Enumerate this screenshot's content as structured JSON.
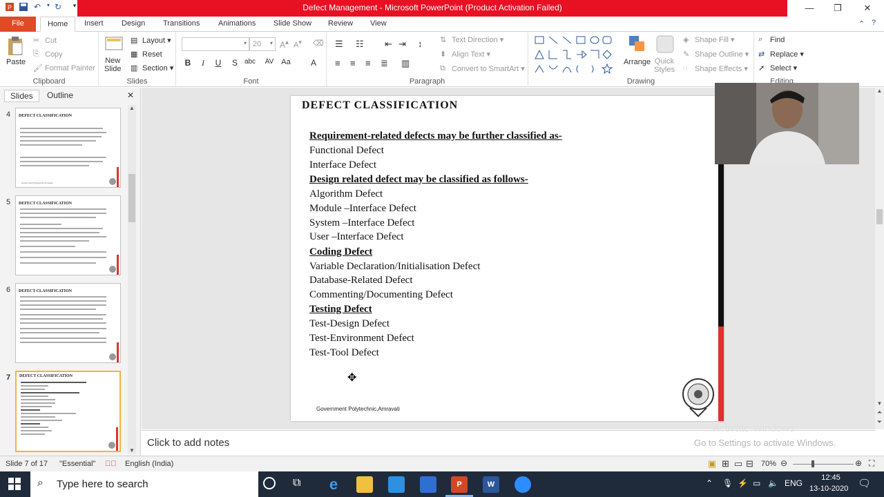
{
  "window": {
    "title": "Defect Management - Microsoft PowerPoint (Product Activation Failed)",
    "minimize": "—",
    "maximize": "❐",
    "close": "✕"
  },
  "tabs": [
    "File",
    "Home",
    "Insert",
    "Design",
    "Transitions",
    "Animations",
    "Slide Show",
    "Review",
    "View"
  ],
  "ribbon": {
    "clipboard": {
      "label": "Clipboard",
      "paste": "Paste",
      "cut": "Cut",
      "copy": "Copy",
      "format_painter": "Format Painter"
    },
    "slides": {
      "label": "Slides",
      "new_slide": "New Slide",
      "new_slide_l1": "New",
      "new_slide_l2": "Slide",
      "layout": "Layout",
      "reset": "Reset",
      "section": "Section"
    },
    "font": {
      "label": "Font",
      "font_name": "",
      "font_size": "20"
    },
    "paragraph": {
      "label": "Paragraph",
      "text_direction": "Text Direction",
      "align_text": "Align Text",
      "convert_smartart": "Convert to SmartArt"
    },
    "drawing": {
      "label": "Drawing",
      "arrange": "Arrange",
      "quick_styles": "Quick Styles",
      "quick_l1": "Quick",
      "quick_l2": "Styles",
      "shape_fill": "Shape Fill",
      "shape_outline": "Shape Outline",
      "shape_effects": "Shape Effects"
    },
    "editing": {
      "label": "Editing",
      "find": "Find",
      "replace": "Replace",
      "select": "Select"
    }
  },
  "left_pane": {
    "tab_slides": "Slides",
    "tab_outline": "Outline",
    "thumbs": [
      {
        "num": "4",
        "title": "DEFECT CLASSIFICATION"
      },
      {
        "num": "5",
        "title": "DEFECT CLASSIFICATION"
      },
      {
        "num": "6",
        "title": "DEFECT CLASSIFICATION"
      },
      {
        "num": "7",
        "title": "DEFECT CLASSIFICATION"
      }
    ],
    "thumb_footer": "Government Polytechnic,Amravati"
  },
  "slide": {
    "title": "DEFECT CLASSIFICATION",
    "lines": [
      {
        "text": "Requirement-related defects may be further classified as-",
        "u": true
      },
      {
        "text": "Functional Defect",
        "u": false
      },
      {
        "text": "Interface Defect",
        "u": false
      },
      {
        "text": "Design related defect may be classified as follows-",
        "u": true
      },
      {
        "text": "Algorithm  Defect",
        "u": false
      },
      {
        "text": "Module –Interface Defect",
        "u": false
      },
      {
        "text": "System –Interface Defect",
        "u": false
      },
      {
        "text": "User –Interface Defect",
        "u": false
      },
      {
        "text": "Coding Defect",
        "u": true
      },
      {
        "text": "Variable  Declaration/Initialisation  Defect",
        "u": false
      },
      {
        "text": "Database-Related Defect",
        "u": false
      },
      {
        "text": "Commenting/Documenting  Defect",
        "u": false
      },
      {
        "text": "Testing Defect",
        "u": true
      },
      {
        "text": "Test-Design Defect",
        "u": false
      },
      {
        "text": "Test-Environment Defect",
        "u": false
      },
      {
        "text": "Test-Tool Defect",
        "u": false
      }
    ],
    "footer": "Government Polytechnic,Amravati"
  },
  "notes_placeholder": "Click to add notes",
  "activation": {
    "line1": "Activate Windows",
    "line2": "Go to Settings to activate Windows."
  },
  "status": {
    "slide_info": "Slide 7 of 17",
    "theme": "\"Essential\"",
    "language": "English (India)",
    "zoom": "70%"
  },
  "taskbar": {
    "search_placeholder": "Type here to search",
    "time": "12:45",
    "date": "13-10-2020",
    "lang": "ENG"
  },
  "colors": {
    "accent_red": "#e81123",
    "file_tab": "#e04a25",
    "slide_bar_red": "#e03030",
    "taskbar": "#1f2a3a"
  }
}
